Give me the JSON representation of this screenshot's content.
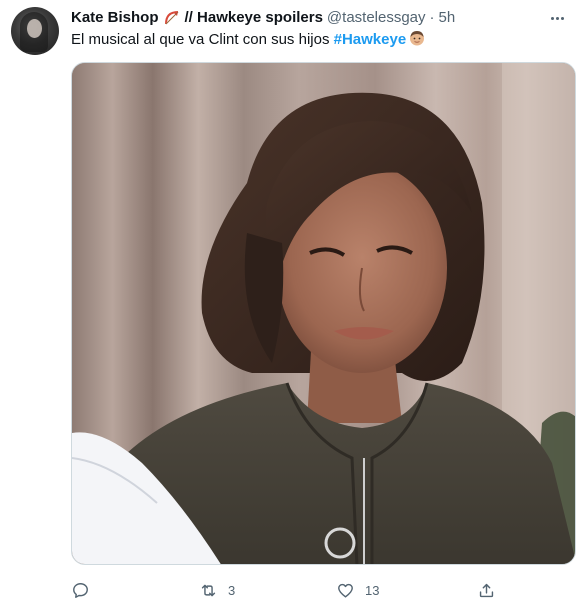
{
  "tweet": {
    "display_name": "Kate Bishop",
    "display_name_suffix": "// Hawkeye spoilers",
    "handle": "@tastelessgay",
    "separator": "·",
    "time": "5h",
    "text": "El musical al que va Clint con sus hijos ",
    "hashtag": "#Hawkeye",
    "emoji_name_icon": "bow-and-arrow-icon",
    "emoji_text_icon": "man-face-icon",
    "media_description_icon": "photo-icon"
  },
  "actions": {
    "reply_count": "",
    "retweet_count": "3",
    "like_count": "13",
    "share_count": ""
  },
  "colors": {
    "link": "#1d9bf0",
    "secondary_text": "#536471",
    "primary_text": "#0f1419",
    "border": "#cfd9de"
  }
}
